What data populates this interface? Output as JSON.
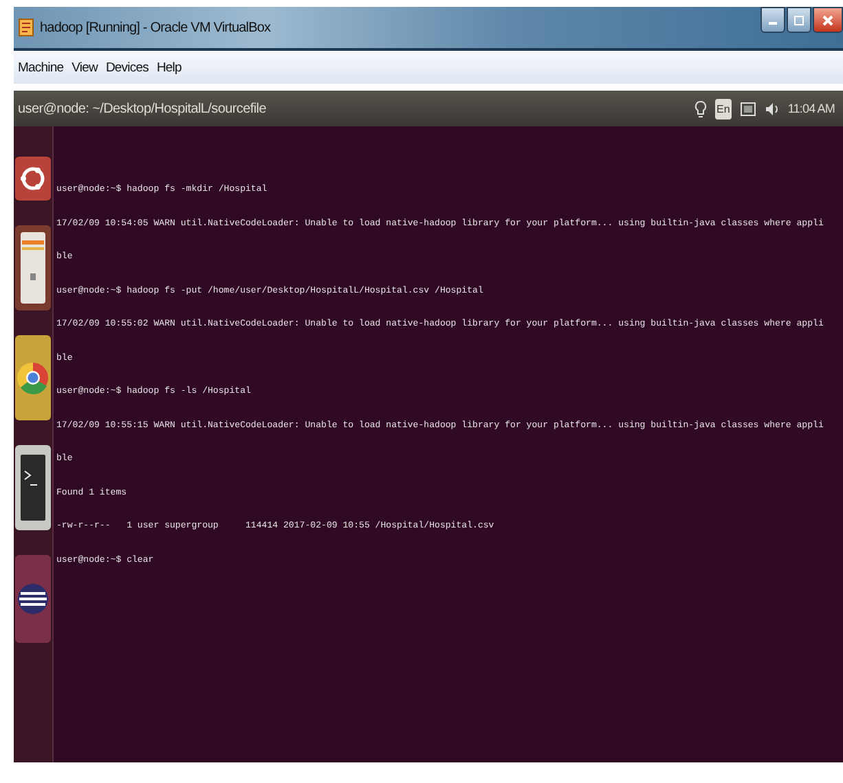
{
  "window": {
    "title": "hadoop [Running] - Oracle VM VirtualBox"
  },
  "menu": [
    "Machine",
    "View",
    "Devices",
    "Help"
  ],
  "panel": {
    "title": "user@node: ~/Desktop/HospitalL/sourcefile",
    "keyboard": "En",
    "clock": "11:04 AM"
  },
  "launcher": [
    {
      "kind": "ubuntu"
    },
    {
      "kind": "files"
    },
    {
      "kind": "browser"
    },
    {
      "kind": "terminal"
    },
    {
      "kind": "eclipse"
    }
  ],
  "terminal": {
    "lines": [
      "user@node:~$ hadoop fs -mkdir /Hospital",
      "17/02/09 10:54:05 WARN util.NativeCodeLoader: Unable to load native-hadoop library for your platform... using builtin-java classes where appli",
      "ble",
      "user@node:~$ hadoop fs -put /home/user/Desktop/HospitalL/Hospital.csv /Hospital",
      "17/02/09 10:55:02 WARN util.NativeCodeLoader: Unable to load native-hadoop library for your platform... using builtin-java classes where appli",
      "ble",
      "user@node:~$ hadoop fs -ls /Hospital",
      "17/02/09 10:55:15 WARN util.NativeCodeLoader: Unable to load native-hadoop library for your platform... using builtin-java classes where appli",
      "ble",
      "Found 1 items",
      "-rw-r--r--   1 user supergroup     114414 2017-02-09 10:55 /Hospital/Hospital.csv",
      "user@node:~$ clear"
    ]
  }
}
